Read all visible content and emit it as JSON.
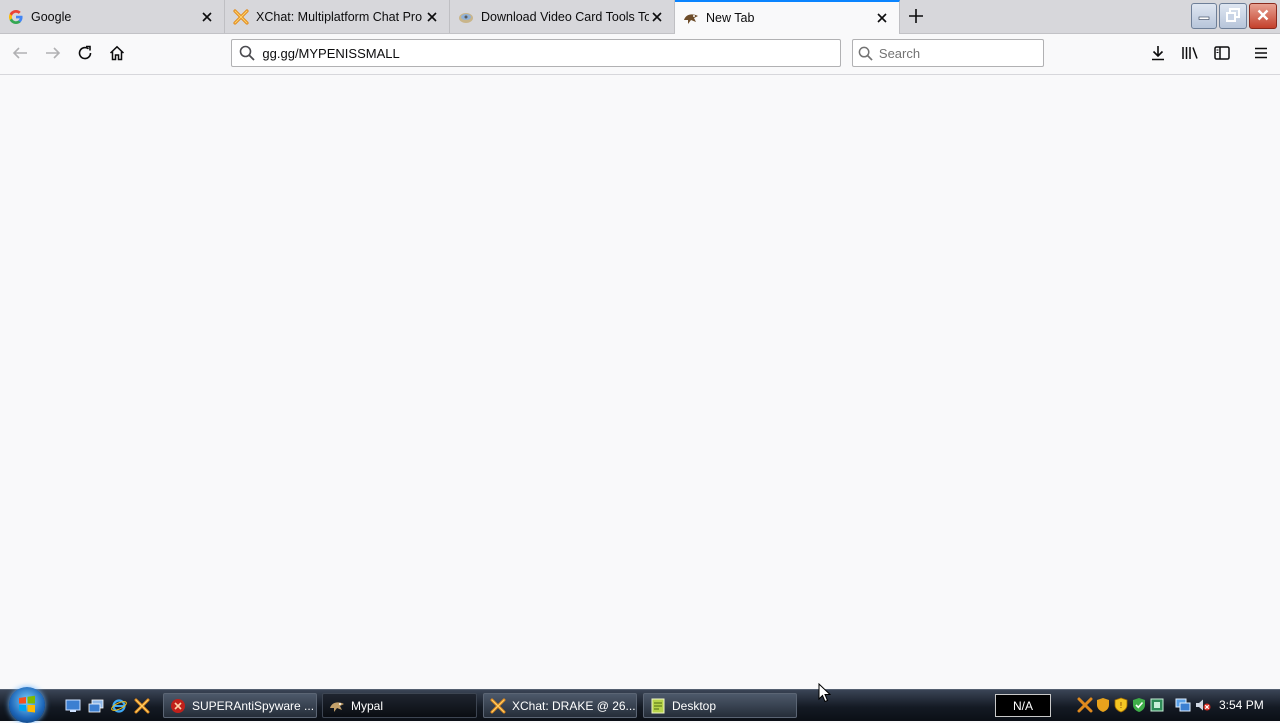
{
  "browser": {
    "tabs": [
      {
        "title": "Google",
        "icon": "google-g-icon"
      },
      {
        "title": "XChat: Multiplatform Chat Pro",
        "icon": "xchat-icon"
      },
      {
        "title": "Download Video Card Tools To",
        "icon": "video-card-icon"
      },
      {
        "title": "New Tab",
        "icon": "new-tab-icon",
        "selected": true
      }
    ],
    "url": "gg.gg/MYPENISSMALL",
    "search_placeholder": "Search",
    "accent_color": "#0a84ff"
  },
  "taskbar": {
    "tasks": [
      {
        "label": "SUPERAntiSpyware ...",
        "icon": "superantispyware-icon"
      },
      {
        "label": "Mypal",
        "icon": "mypal-icon",
        "active": true
      },
      {
        "label": "XChat: DRAKE @ 26...",
        "icon": "xchat-icon"
      },
      {
        "label": "Desktop",
        "icon": "folder-icon"
      }
    ],
    "na_label": "N/A",
    "clock": "3:54 PM"
  }
}
